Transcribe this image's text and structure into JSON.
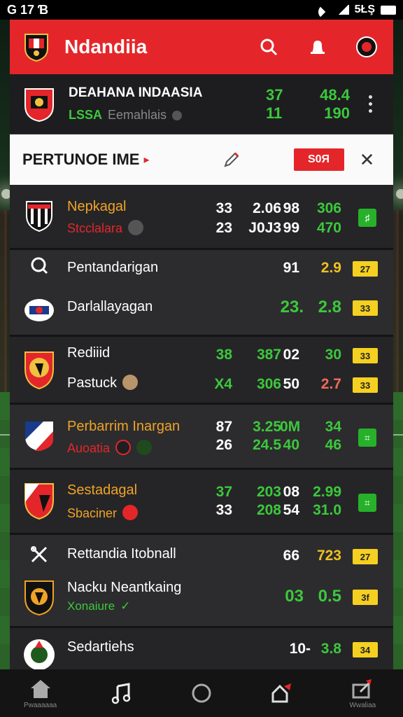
{
  "status_bar": {
    "time": "G 17 Ɓ",
    "battery_text": "5ŁŞ"
  },
  "header": {
    "title": "Ndandiia"
  },
  "league": {
    "name": "DEAHANA INDAASIA",
    "sub_green": "LSSA",
    "sub_gray": "Eemahlais",
    "nums": [
      [
        "37",
        "48.4"
      ],
      [
        "11",
        "190"
      ]
    ]
  },
  "filter": {
    "title": "PERTUNOE IME",
    "badge": "S0Я"
  },
  "matches": [
    {
      "team1": "Nepkagal",
      "team2": "Stcclalara",
      "n": {
        "a1": "33",
        "b1": "2.06",
        "c1": "98",
        "d1": "306",
        "a2": "23",
        "b2": "J0J3",
        "c2": "99",
        "d2": "470"
      }
    },
    {
      "team1": "Pentandarigan",
      "team2": "Darlallayagan",
      "n": {
        "c1": "91",
        "d1": "2.9",
        "b2": "23.",
        "d2": "2.8"
      },
      "badges": [
        "27",
        "33"
      ]
    },
    {
      "team1": "Rediiid",
      "team2": "Pastuck",
      "n": {
        "a1": "38",
        "b1": "387",
        "c1": "02",
        "d1": "30",
        "a2": "X4",
        "b2": "306",
        "c2": "50",
        "d2": "2.7"
      },
      "badges": [
        "33",
        "33"
      ]
    },
    {
      "team1": "Perbarrim Inargan",
      "team2": "Auoatia",
      "n": {
        "a1": "87",
        "b1": "3.25",
        "c1": "0M",
        "d1": "34",
        "a2": "26",
        "b2": "24.5",
        "c2": "40",
        "d2": "46"
      }
    },
    {
      "team1": "Sestadagal",
      "team2": "Sbaciner",
      "n": {
        "a1": "37",
        "b1": "203",
        "c1": "08",
        "d1": "2.99",
        "a2": "33",
        "b2": "208",
        "c2": "54",
        "d2": "31.0"
      }
    },
    {
      "team1": "Rettandia Itobnall",
      "team2": "Nacku Neantkaing",
      "team2_sub": "Xonaiure",
      "n": {
        "c1": "66",
        "d1": "723",
        "b2": "03",
        "d2": "0.5"
      },
      "badges": [
        "27",
        "3f"
      ]
    },
    {
      "team1": "Sedartiehs",
      "n": {
        "c1": "10-",
        "d1": "3.8"
      },
      "badges": [
        "34"
      ]
    }
  ],
  "nav": [
    {
      "label": "Pwaaaaaa",
      "icon": "home-icon"
    },
    {
      "label": "",
      "icon": "music-icon"
    },
    {
      "label": "",
      "icon": "circle-icon"
    },
    {
      "label": "",
      "icon": "share-icon"
    },
    {
      "label": "Wwaliaa",
      "icon": "export-icon"
    }
  ]
}
